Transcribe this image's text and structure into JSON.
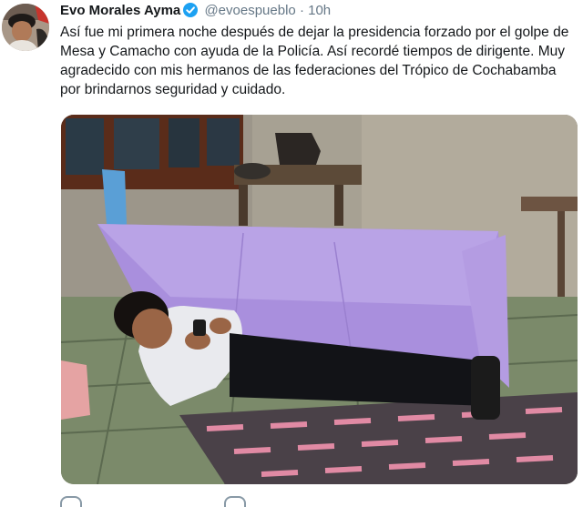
{
  "tweet": {
    "author_name": "Evo Morales Ayma",
    "handle": "@evoespueblo",
    "separator": "·",
    "time": "10h",
    "lines": [
      "Así fue mi primera noche después de dejar la presidencia forzado por el golpe de",
      "Mesa y Camacho con ayuda de la Policía. Así recordé tiempos de dirigente. Muy",
      "agradecido con mis hermanos de las federaciones del Trópico de Cochabamba",
      "por brindarnos seguridad y cuidado."
    ]
  },
  "icons": {
    "verified": "verified-badge-icon",
    "reply": "reply-icon",
    "retweet": "retweet-icon"
  },
  "colors": {
    "verified": "#1da1f2",
    "text": "#14171a",
    "muted": "#657786",
    "net": "#a98fdd"
  }
}
